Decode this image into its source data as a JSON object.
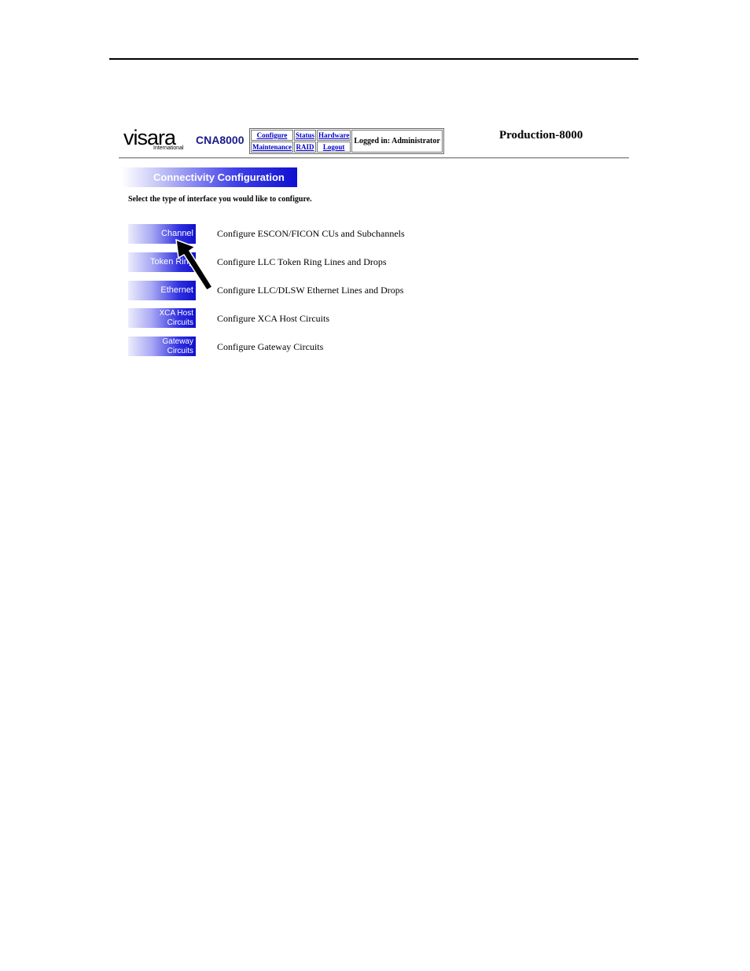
{
  "header": {
    "logo_text": "visara",
    "logo_subtext": "International",
    "product": "CNA8000",
    "nav": {
      "configure": "Configure",
      "status": "Status",
      "hardware": "Hardware",
      "maintenance": "Maintenance",
      "raid": "RAID",
      "logout": "Logout"
    },
    "logged_in": "Logged in: Administrator",
    "site_name": "Production-8000"
  },
  "section_title": "Connectivity Configuration",
  "instructions": "Select the type of interface you would like to configure.",
  "options": [
    {
      "label": "Channel",
      "description": "Configure ESCON/FICON CUs and Subchannels"
    },
    {
      "label": "Token Ring",
      "description": "Configure LLC Token Ring Lines and Drops"
    },
    {
      "label": "Ethernet",
      "description": "Configure LLC/DLSW Ethernet Lines and Drops"
    },
    {
      "label_line1": "XCA Host",
      "label_line2": "Circuits",
      "description": "Configure XCA Host Circuits"
    },
    {
      "label_line1": "Gateway",
      "label_line2": "Circuits",
      "description": "Configure Gateway Circuits"
    }
  ],
  "annotation": {
    "arrow_color": "#000000"
  }
}
